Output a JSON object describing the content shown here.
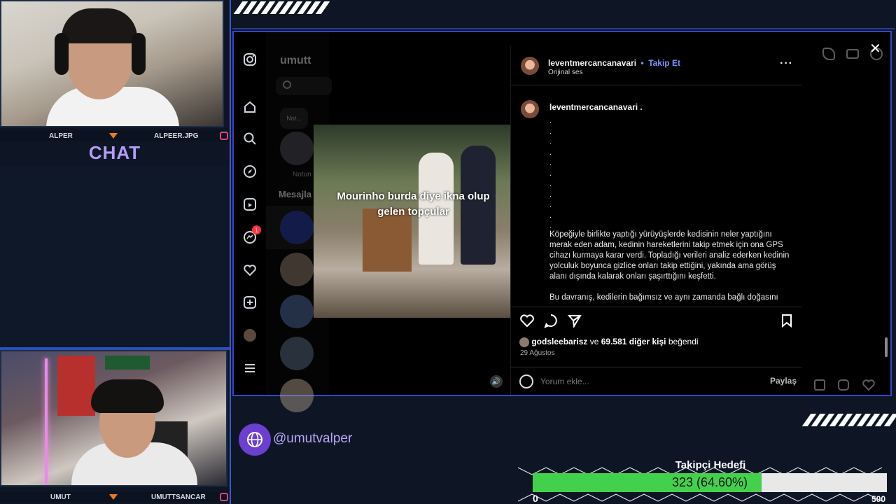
{
  "stream": {
    "top_cam": {
      "left_name": "ALPER",
      "right_name": "ALPEER.JPG"
    },
    "bottom_cam": {
      "left_name": "UMUT",
      "right_name": "UMUTTSANCAR"
    },
    "chat_title": "CHAT",
    "handle": "@umutvalper",
    "goal": {
      "title": "Takipçi Hedefi",
      "label": "323 (64.60%)",
      "current": 323,
      "fraction": 0.646,
      "min_label": "0",
      "max_label": "500"
    }
  },
  "instagram": {
    "profile_name": "umutt",
    "note_label": "Not...",
    "note_caption": "Notun",
    "messages_label": "Mesajla",
    "notification_count": "1",
    "video_caption": "Mourinho burda diye ikna olup gelen topçular",
    "post": {
      "username": "leventmercancanavari",
      "separator": "•",
      "follow": "Takip Et",
      "audio": "Orijinal ses",
      "caption_user": "leventmercancanavari .",
      "dots": [
        ".",
        ".",
        ".",
        ".",
        ".",
        ".",
        ".",
        ".",
        ".",
        ".",
        "."
      ],
      "caption_p1": "Köpeğiyle birlikte yaptığı yürüyüşlerde kedisinin neler yaptığını merak eden adam, kedinin hareketlerini takip etmek için ona GPS cihazı kurmaya karar verdi. Topladığı verileri analiz ederken kedinin yolculuk boyunca gizlice onları takip ettiğini, yakında ama görüş alanı dışında kalarak onları şaşırttığını keşfetti.",
      "caption_p2": "Bu davranış, kedilerin bağımsız ve aynı zamanda bağlı doğasını",
      "liked_user": "godsleebarisz",
      "liked_mid": "ve",
      "liked_others": "69.581 diğer kişi",
      "liked_suffix": "beğendi",
      "date": "29 Ağustos",
      "comment_placeholder": "Yorum ekle...",
      "share": "Paylaş"
    }
  },
  "icons": [
    "instagram-icon",
    "home-icon",
    "search-icon",
    "explore-icon",
    "reels-icon",
    "messenger-icon",
    "heart-icon",
    "create-icon",
    "menu-icon",
    "close-icon",
    "more-icon",
    "like-icon",
    "comment-icon",
    "share-icon",
    "bookmark-icon",
    "emoji-icon",
    "phone-icon",
    "video-call-icon",
    "info-icon",
    "gallery-icon",
    "sticker-icon",
    "speaker-icon",
    "globe-icon"
  ],
  "colors": {
    "accent_purple": "#b59cf5",
    "follow_blue": "#7d93ff",
    "goal_green": "#43d14d",
    "frame_blue": "#3546c9",
    "arrow_orange": "#f07a1e"
  }
}
